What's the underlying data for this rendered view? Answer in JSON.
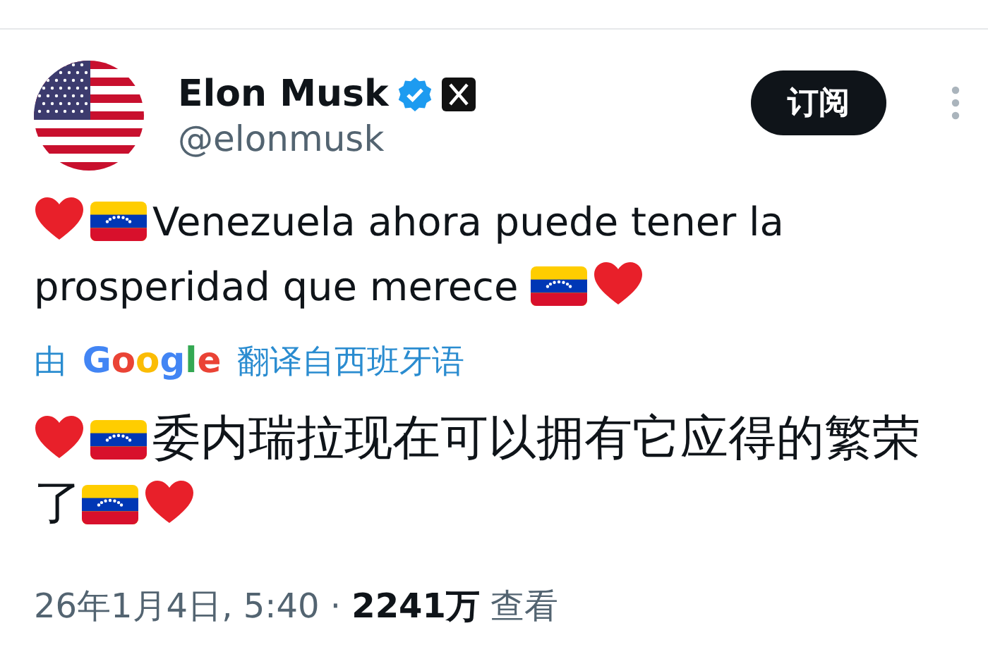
{
  "author": {
    "name": "Elon Musk",
    "verified": true,
    "handle": "@elonmusk"
  },
  "subscribe_button": "订阅",
  "post": {
    "parts": [
      {
        "kind": "heart"
      },
      {
        "kind": "flag"
      },
      {
        "kind": "text",
        "text": "Venezuela ahora puede tener la"
      },
      {
        "kind": "text",
        "text": "prosperidad que merece"
      },
      {
        "kind": "flag"
      },
      {
        "kind": "heart"
      }
    ]
  },
  "translation_note": {
    "prefix": "由",
    "brand": "Google",
    "suffix": "翻译自西班牙语"
  },
  "translation": {
    "parts": [
      {
        "kind": "heart"
      },
      {
        "kind": "flag"
      },
      {
        "kind": "text",
        "text": "委内瑞拉现在可以拥有它应得的繁荣"
      },
      {
        "kind": "text",
        "text": "了"
      },
      {
        "kind": "flag"
      },
      {
        "kind": "heart"
      }
    ]
  },
  "footer": "26年1月4日, 5:40 · **2241万** 查看"
}
